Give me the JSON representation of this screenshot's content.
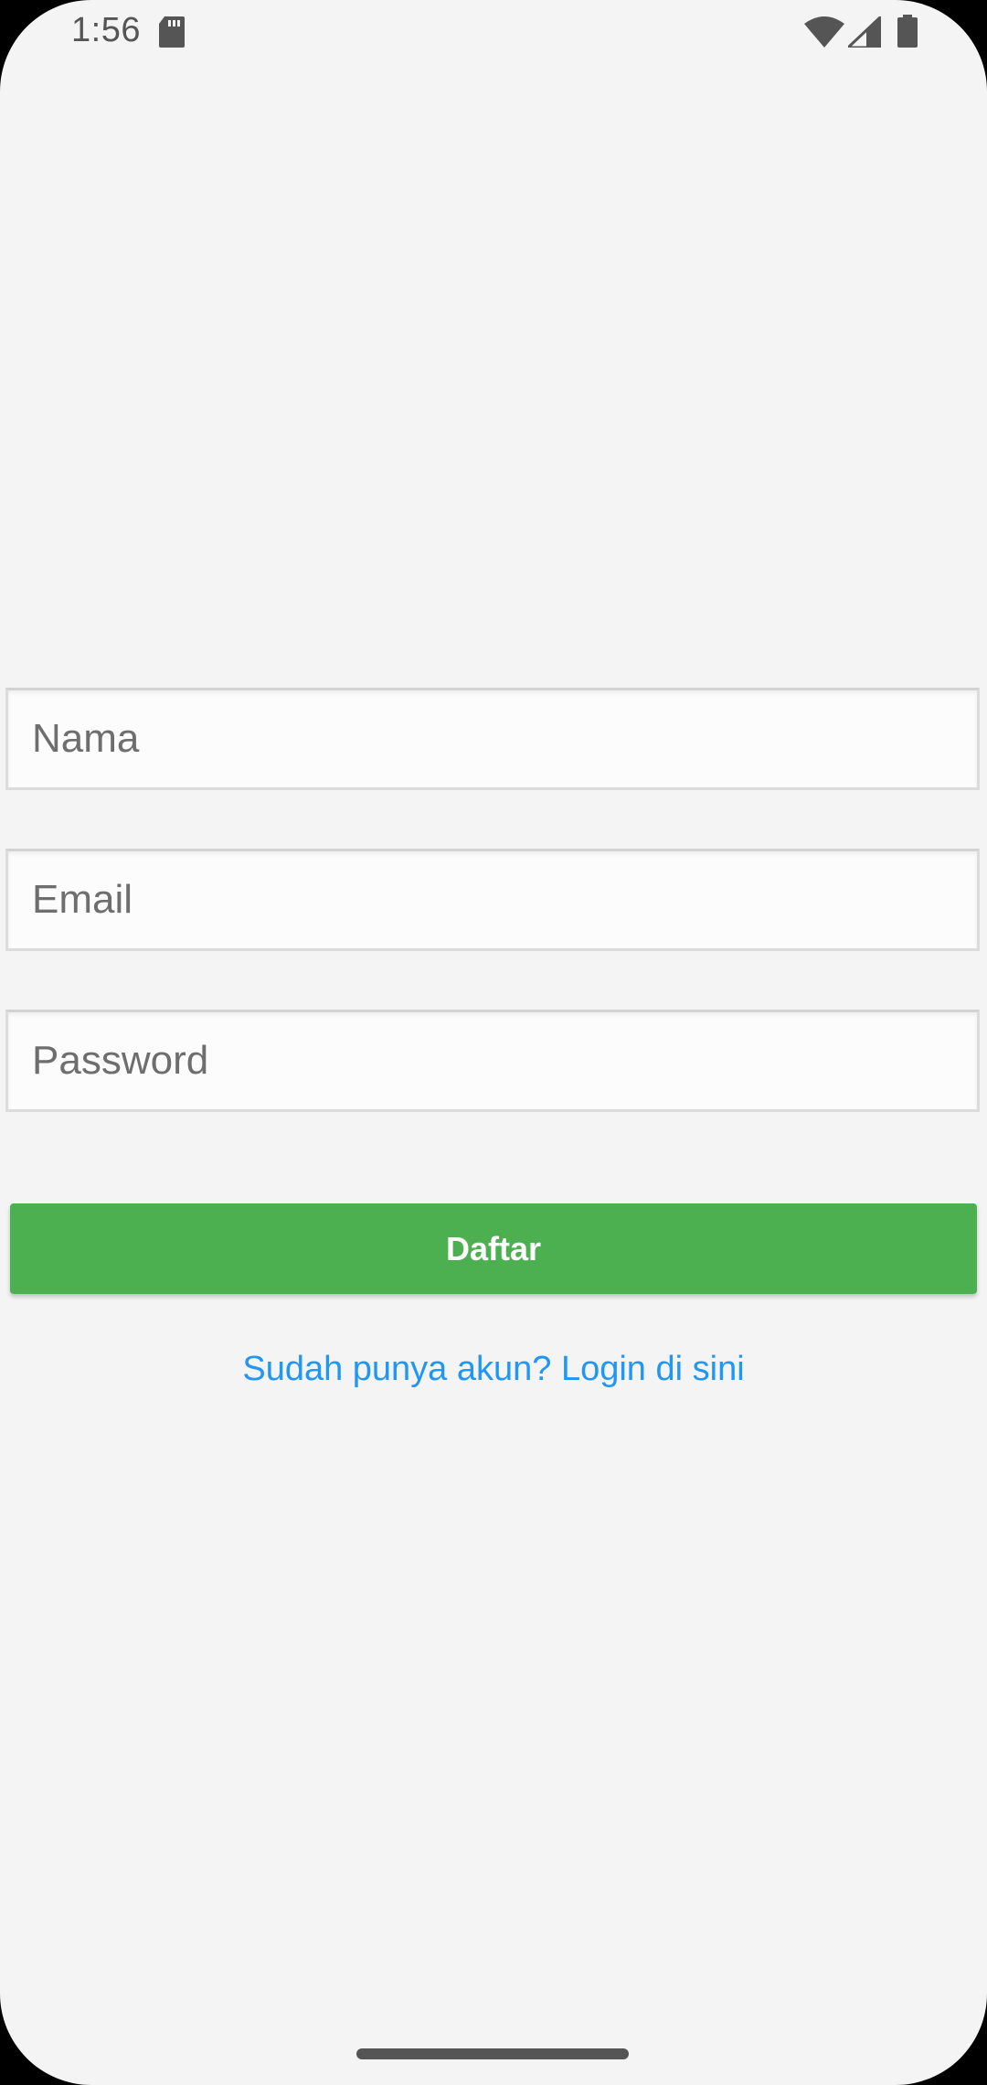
{
  "status_bar": {
    "time": "1:56",
    "icons": [
      "sd-card-icon",
      "wifi-icon",
      "signal-icon",
      "battery-icon"
    ]
  },
  "form": {
    "name_placeholder": "Nama",
    "email_placeholder": "Email",
    "password_placeholder": "Password",
    "submit_label": "Daftar",
    "login_link": "Sudah punya akun? Login di sini"
  },
  "colors": {
    "background": "#f4f4f4",
    "primary_button": "#4caf50",
    "link": "#2196f3"
  }
}
